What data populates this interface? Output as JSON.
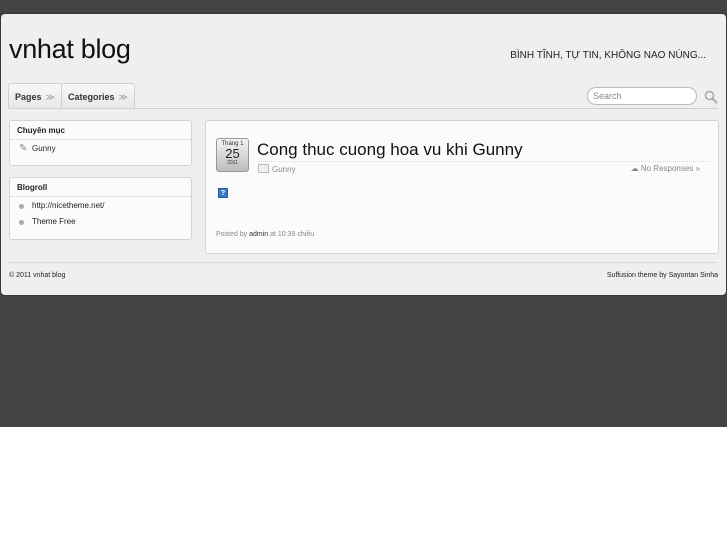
{
  "header": {
    "blog_title": "vnhat blog",
    "tagline": "BÌNH TĨNH, TỰ TIN, KHÔNG NAO NÚNG..."
  },
  "nav": {
    "pages_label": "Pages",
    "categories_label": "Categories",
    "chevron": "≫",
    "search_placeholder": "Search"
  },
  "sidebar": {
    "categories_widget": {
      "title": "Chuyên mục",
      "items": [
        "Gunny"
      ]
    },
    "blogroll_widget": {
      "title": "Blogroll",
      "items": [
        "http://nicetheme.net/",
        "Theme Free"
      ]
    }
  },
  "post": {
    "date_month": "Tháng 1",
    "date_day": "25",
    "date_year": "2011",
    "title": "Cong thuc cuong hoa vu khi Gunny",
    "category": "Gunny",
    "responses": "No Responses »",
    "broken_image": "?",
    "posted_by_prefix": "Posted by",
    "author": "admin",
    "time_text": "at 10:39 chiều"
  },
  "footer": {
    "copyright": "© 2011 vnhat blog",
    "credit": "Suffusion theme by Sayontan Sinha"
  }
}
